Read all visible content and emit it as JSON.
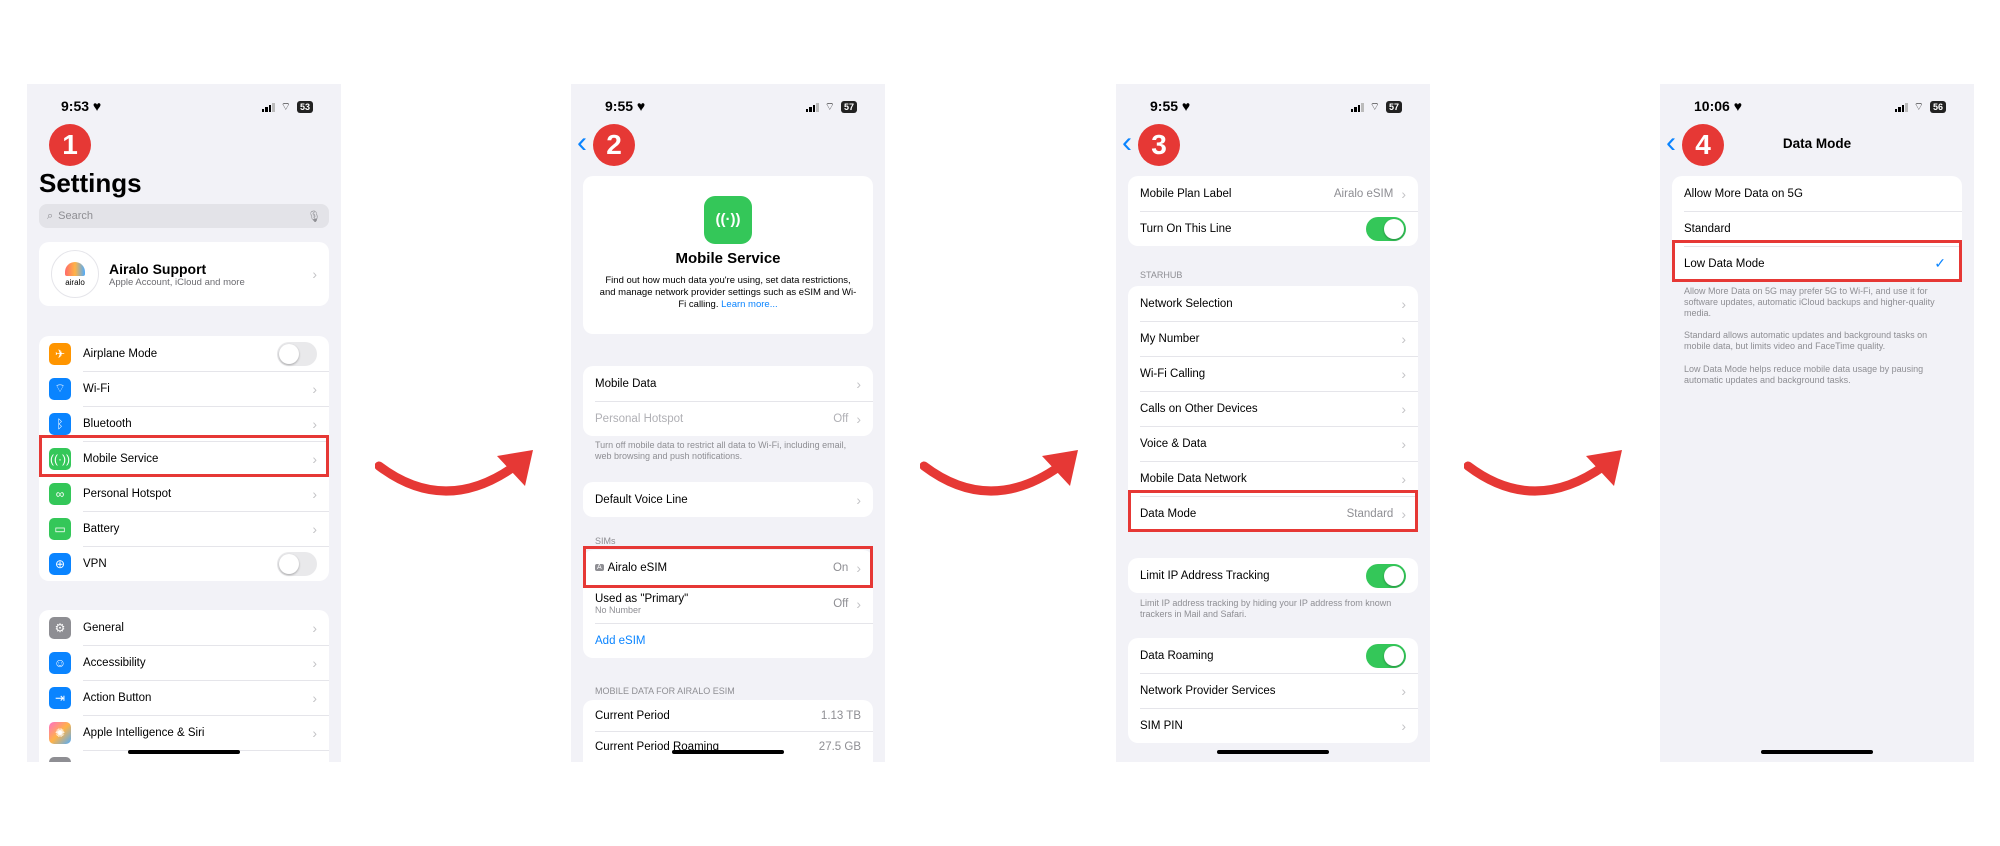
{
  "phone1": {
    "time": "9:53 ♥",
    "battery": "53",
    "step": "1",
    "title": "Settings",
    "search_placeholder": "Search",
    "account": {
      "name": "Airalo Support",
      "subtitle": "Apple Account, iCloud and more",
      "avatar_text": "airalo"
    },
    "group1": [
      {
        "label": "Airplane Mode",
        "icon": "airplane-icon",
        "color": "#ff9500",
        "toggle": "off"
      },
      {
        "label": "Wi-Fi",
        "icon": "wifi-icon",
        "color": "#0a84ff"
      },
      {
        "label": "Bluetooth",
        "icon": "bluetooth-icon",
        "color": "#0a84ff"
      },
      {
        "label": "Mobile Service",
        "icon": "antenna-icon",
        "color": "#34c759"
      },
      {
        "label": "Personal Hotspot",
        "icon": "hotspot-icon",
        "color": "#34c759"
      },
      {
        "label": "Battery",
        "icon": "battery-icon",
        "color": "#34c759"
      },
      {
        "label": "VPN",
        "icon": "globe-icon",
        "color": "#0a84ff",
        "toggle": "off"
      }
    ],
    "group2": [
      {
        "label": "General",
        "icon": "gear-icon",
        "color": "#8e8e93"
      },
      {
        "label": "Accessibility",
        "icon": "accessibility-icon",
        "color": "#0a84ff"
      },
      {
        "label": "Action Button",
        "icon": "action-button-icon",
        "color": "#0a84ff"
      },
      {
        "label": "Apple Intelligence & Siri",
        "icon": "siri-icon",
        "color": "#ff6ec7"
      }
    ]
  },
  "phone2": {
    "time": "9:55 ♥",
    "battery": "57",
    "step": "2",
    "card_title": "Mobile Service",
    "card_text": "Find out how much data you're using, set data restrictions, and manage network provider settings such as eSIM and Wi-Fi calling.",
    "learn_more": "Learn more...",
    "mobile_data": "Mobile Data",
    "personal_hotspot": "Personal Hotspot",
    "hotspot_value": "Off",
    "data_footnote": "Turn off mobile data to restrict all data to Wi-Fi, including email, web browsing and push notifications.",
    "default_voice_line": "Default Voice Line",
    "sims_header": "SIMs",
    "esim_label": "Airalo eSIM",
    "esim_badge": "A",
    "esim_value": "On",
    "primary_label": "Used as \"Primary\"",
    "primary_sub": "No Number",
    "primary_value": "Off",
    "add_esim": "Add eSIM",
    "usage_header": "MOBILE DATA FOR AIRALO ESIM",
    "current_period": "Current Period",
    "current_period_value": "1.13 TB",
    "current_roaming": "Current Period Roaming",
    "current_roaming_value": "27.5 GB"
  },
  "phone3": {
    "time": "9:55 ♥",
    "battery": "57",
    "step": "3",
    "plan_label": "Mobile Plan Label",
    "plan_value": "Airalo eSIM",
    "turn_on_line": "Turn On This Line",
    "section_header": "STARHUB",
    "rows": [
      "Network Selection",
      "My Number",
      "Wi-Fi Calling",
      "Calls on Other Devices",
      "Voice & Data",
      "Mobile Data Network"
    ],
    "data_mode": "Data Mode",
    "data_mode_value": "Standard",
    "limit_ip": "Limit IP Address Tracking",
    "limit_ip_footnote": "Limit IP address tracking by hiding your IP address from known trackers in Mail and Safari.",
    "data_roaming": "Data Roaming",
    "provider_services": "Network Provider Services",
    "sim_pin": "SIM PIN"
  },
  "phone4": {
    "time": "10:06 ♥",
    "battery": "56",
    "step": "4",
    "nav_title": "Data Mode",
    "options": [
      "Allow More Data on 5G",
      "Standard",
      "Low Data Mode"
    ],
    "selected": "Low Data Mode",
    "check": "✓",
    "footnote1": "Allow More Data on 5G may prefer 5G to Wi-Fi, and use it for software updates, automatic iCloud backups and higher-quality media.",
    "footnote2": "Standard allows automatic updates and background tasks on mobile data, but limits video and FaceTime quality.",
    "footnote3": "Low Data Mode helps reduce mobile data usage by pausing automatic updates and background tasks."
  },
  "colors": {
    "accent_red": "#e63835",
    "ios_blue": "#0a84ff",
    "ios_green": "#34c759"
  }
}
